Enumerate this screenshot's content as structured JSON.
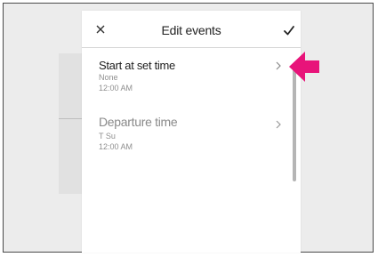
{
  "header": {
    "close_icon": "close-icon",
    "title": "Edit events",
    "confirm_icon": "checkmark-icon"
  },
  "events": [
    {
      "title": "Start at set time",
      "repeat": "None",
      "time": "12:00 AM",
      "state": "active"
    },
    {
      "title": "Departure time",
      "repeat": "T Su",
      "time": "12:00 AM",
      "state": "inactive"
    }
  ],
  "colors": {
    "pointer_arrow": "#e8147a",
    "active_title": "#1e1e1e",
    "inactive_title": "#8a8a8a",
    "secondary_text": "#8f8f8f"
  }
}
